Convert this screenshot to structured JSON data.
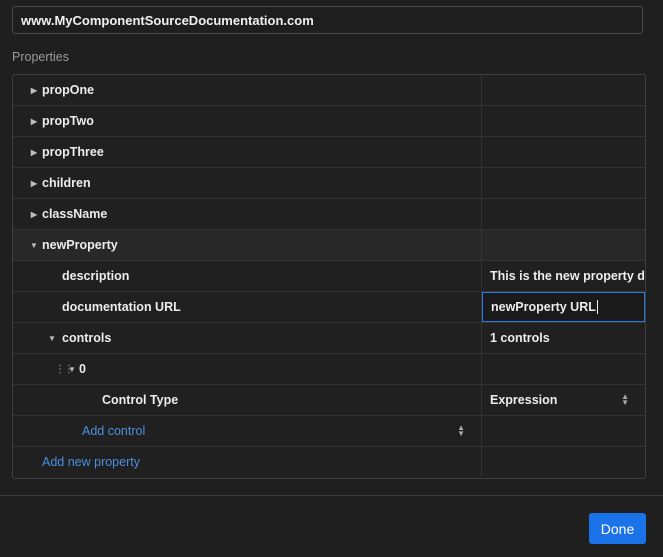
{
  "url_field": {
    "value": "www.MyComponentSourceDocumentation.com"
  },
  "section_label": "Properties",
  "properties": [
    {
      "name": "propOne",
      "expanded": false
    },
    {
      "name": "propTwo",
      "expanded": false
    },
    {
      "name": "propThree",
      "expanded": false
    },
    {
      "name": "children",
      "expanded": false
    },
    {
      "name": "className",
      "expanded": false
    },
    {
      "name": "newProperty",
      "expanded": true
    }
  ],
  "new_property": {
    "description_label": "description",
    "description_value": "This is the new property d",
    "doc_url_label": "documentation URL",
    "doc_url_value": "newProperty URL",
    "controls_label": "controls",
    "controls_value": "1 controls",
    "control_index": "0",
    "control_type_label": "Control Type",
    "control_type_value": "Expression",
    "add_control_label": "Add control"
  },
  "add_new_property_label": "Add new property",
  "done_label": "Done",
  "colors": {
    "accent": "#1a73e8",
    "link": "#4a90e2",
    "background": "#1f1f1f"
  },
  "icons": [
    "caret-right-icon",
    "caret-down-icon",
    "drag-handle-icon",
    "stepper-icon"
  ]
}
